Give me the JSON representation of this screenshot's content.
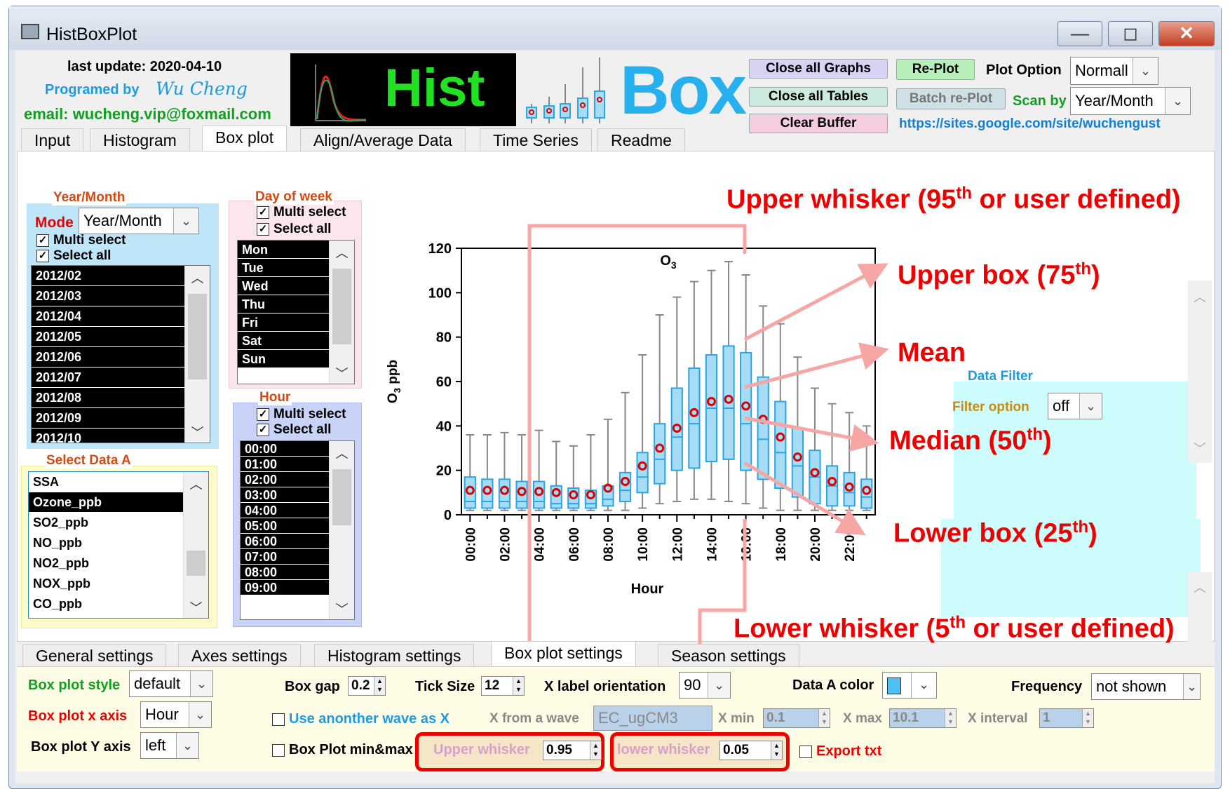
{
  "window": {
    "title": "HistBoxPlot"
  },
  "header": {
    "last_update": "last update: 2020-04-10",
    "programmed_by": "Programed by",
    "author": "Wu Cheng",
    "email": "email: wucheng.vip@foxmail.com",
    "logo_hist": "Hist",
    "logo_box": "Box"
  },
  "toolbar": {
    "close_graphs": "Close all Graphs",
    "close_tables": "Close all Tables",
    "clear_buffer": "Clear Buffer",
    "replot": "Re-Plot",
    "batch_replot": "Batch re-Plot",
    "plot_option_label": "Plot Option",
    "plot_option_value": "Normall",
    "scan_by_label": "Scan by",
    "scan_by_value": "Year/Month",
    "url": "https://sites.google.com/site/wuchengust"
  },
  "tabs": [
    "Input",
    "Histogram",
    "Box plot",
    "Align/Average Data",
    "Time Series",
    "Readme"
  ],
  "year_month": {
    "title": "Year/Month",
    "mode_label": "Mode",
    "mode_value": "Year/Month",
    "multi_select": "Multi select",
    "select_all": "Select all",
    "items": [
      "2012/02",
      "2012/03",
      "2012/04",
      "2012/05",
      "2012/06",
      "2012/07",
      "2012/08",
      "2012/09",
      "2012/10"
    ]
  },
  "day_of_week": {
    "title": "Day of week",
    "multi_select": "Multi select",
    "select_all": "Select all",
    "items": [
      "Mon",
      "Tue",
      "Wed",
      "Thu",
      "Fri",
      "Sat",
      "Sun"
    ]
  },
  "hour": {
    "title": "Hour",
    "multi_select": "Multi select",
    "select_all": "Select all",
    "items": [
      "00:00",
      "01:00",
      "02:00",
      "03:00",
      "04:00",
      "05:00",
      "06:00",
      "07:00",
      "08:00",
      "09:00"
    ]
  },
  "select_data": {
    "title": "Select Data A",
    "items": [
      "SSA",
      "Ozone_ppb",
      "SO2_ppb",
      "NO_ppb",
      "NO2_ppb",
      "NOX_ppb",
      "CO_ppb"
    ]
  },
  "data_filter": {
    "title": "Data Filter",
    "option_label": "Filter option",
    "option_value": "off"
  },
  "annotations": {
    "upper_whisker": "Upper whisker (95",
    "upper_whisker_tail": " or user defined)",
    "upper_box": "Upper box (75",
    "mean": "Mean",
    "median": "Median (50",
    "lower_box": "Lower box (25",
    "lower_whisker": "Lower whisker (5",
    "lower_whisker_tail": " or user defined)",
    "th": "th",
    "close": ")"
  },
  "chart_data": {
    "type": "box",
    "title": "O3",
    "ylabel": "O3 ppb",
    "xlabel": "Hour",
    "ylim": [
      0,
      120
    ],
    "yticks": [
      0,
      20,
      40,
      60,
      80,
      100,
      120
    ],
    "categories": [
      "00:00",
      "01:00",
      "02:00",
      "03:00",
      "04:00",
      "05:00",
      "06:00",
      "07:00",
      "08:00",
      "09:00",
      "10:00",
      "11:00",
      "12:00",
      "13:00",
      "14:00",
      "15:00",
      "16:00",
      "17:00",
      "18:00",
      "19:00",
      "20:00",
      "21:00",
      "22:00",
      "23:00"
    ],
    "xtick_labels": [
      "00:00",
      "02:00",
      "04:00",
      "06:00",
      "08:00",
      "10:00",
      "12:00",
      "14:00",
      "16:00",
      "18:00",
      "20:00",
      "22:00"
    ],
    "whisker_low": [
      2,
      2,
      2,
      2,
      2,
      2,
      2,
      2,
      2,
      2,
      3,
      5,
      6,
      7,
      7,
      6,
      5,
      3,
      2,
      2,
      2,
      2,
      2,
      2
    ],
    "q1": [
      3,
      3,
      3,
      3,
      3,
      3,
      3,
      3,
      4,
      6,
      10,
      14,
      20,
      21,
      24,
      25,
      20,
      16,
      12,
      8,
      5,
      4,
      4,
      3
    ],
    "median": [
      6,
      6,
      6,
      6,
      6,
      5,
      5,
      5,
      7,
      11,
      17,
      25,
      35,
      41,
      48,
      48,
      41,
      34,
      28,
      22,
      17,
      13,
      10,
      8
    ],
    "q3": [
      17,
      16,
      16,
      15,
      15,
      13,
      12,
      11,
      13,
      19,
      28,
      41,
      57,
      66,
      72,
      76,
      73,
      62,
      51,
      39,
      29,
      22,
      19,
      16
    ],
    "whisker_high": [
      36,
      36,
      37,
      36,
      38,
      33,
      31,
      36,
      43,
      55,
      72,
      90,
      98,
      105,
      110,
      114,
      108,
      94,
      86,
      71,
      57,
      50,
      46,
      40
    ],
    "mean": [
      11,
      11,
      11,
      10.5,
      10.5,
      10,
      9,
      9,
      12,
      15,
      22,
      30,
      39,
      46,
      51,
      52,
      49,
      43,
      35,
      26,
      19,
      15,
      12.5,
      11
    ]
  },
  "bottom_tabs": [
    "General settings",
    "Axes settings",
    "Histogram settings",
    "Box plot settings",
    "Season settings"
  ],
  "settings": {
    "style_label": "Box plot style",
    "style_value": "default",
    "xaxis_label": "Box plot x axis",
    "xaxis_value": "Hour",
    "yaxis_label": "Box plot Y axis",
    "yaxis_value": "left",
    "box_gap_label": "Box gap",
    "box_gap_value": "0.2",
    "tick_size_label": "Tick Size",
    "tick_size_value": "12",
    "xlabel_orient_label": "X label orientation",
    "xlabel_orient_value": "90",
    "data_color_label": "Data A color",
    "frequency_label": "Frequency",
    "frequency_value": "not shown",
    "use_wave_label": "Use anonther wave as X",
    "x_from_wave_label": "X from a wave",
    "x_from_wave_value": "EC_ugCM3",
    "xmin_label": "X min",
    "xmin_value": "0.1",
    "xmax_label": "X max",
    "xmax_value": "10.1",
    "xint_label": "X interval",
    "xint_value": "1",
    "minmax_label": "Box Plot min&max",
    "upper_whisker_label": "Upper whisker",
    "upper_whisker_value": "0.95",
    "lower_whisker_label": "lower whisker",
    "lower_whisker_value": "0.05",
    "export_label": "Export txt"
  },
  "colors": {
    "box_fill": "#a6dcf5",
    "box_edge": "#2aa6e6",
    "mean": "#dd0000",
    "whisker": "#888888",
    "annotation": "#ee0000",
    "arrow": "#f7a6a6"
  }
}
